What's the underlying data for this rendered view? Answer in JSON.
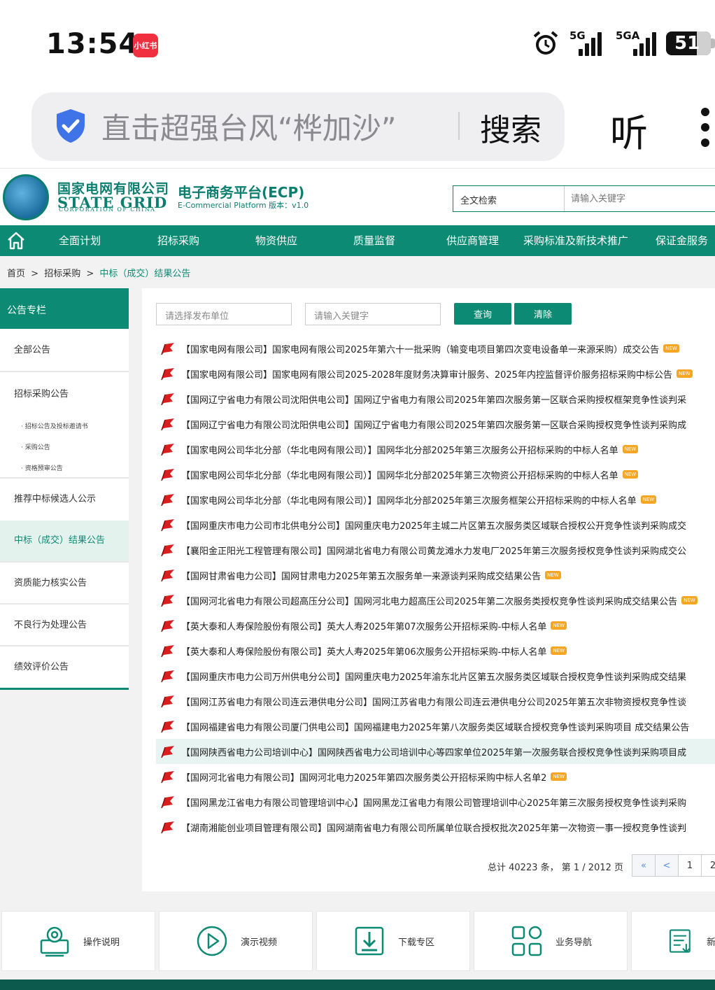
{
  "status_bar": {
    "time": "13:54",
    "app_badge": "小红书",
    "signal1_label": "5G",
    "signal2_label": "5GA",
    "battery": "51"
  },
  "browser": {
    "search_text": "直击超强台风“桦加沙”",
    "search_button": "搜索",
    "listen_button": "听"
  },
  "header": {
    "company_cn": "国家电网有限公司",
    "company_en": "STATE GRID",
    "company_en_sub": "CORPORATION OF CHINA",
    "platform_title": "电子商务平台(ECP)",
    "platform_sub": "E-Commercial Platform 版本：v1.0",
    "fulltext_label": "全文检索",
    "fulltext_placeholder": "请输入关键字"
  },
  "nav": {
    "items": [
      "全面计划",
      "招标采购",
      "物资供应",
      "质量监督",
      "供应商管理",
      "采购标准及新技术推广",
      "保证金服务"
    ]
  },
  "breadcrumb": {
    "home": "首页",
    "sep": ">",
    "level1": "招标采购",
    "current": "中标（成交）结果公告"
  },
  "sidebar": {
    "title": "公告专栏",
    "items": [
      "全部公告",
      "招标采购公告",
      "招标公告及投标邀请书",
      "采购公告",
      "资格预审公告",
      "推荐中标候选人公示",
      "中标（成交）结果公告",
      "资质能力核实公告",
      "不良行为处理公告",
      "绩效评价公告"
    ]
  },
  "filters": {
    "unit_placeholder": "请选择发布单位",
    "keyword_placeholder": "请输入关键字",
    "query_button": "查询",
    "clear_button": "清除"
  },
  "new_label": "NEW",
  "notices": [
    {
      "text": "【国家电网有限公司】国家电网有限公司2025年第六十一批采购（输变电项目第四次变电设备单一来源采购）成交公告",
      "new": true
    },
    {
      "text": "【国家电网有限公司】国家电网有限公司2025-2028年度财务决算审计服务、2025年内控监督评价服务招标采购中标公告",
      "new": true
    },
    {
      "text": "【国网辽宁省电力有限公司沈阳供电公司】国网辽宁省电力有限公司2025年第四次服务第一区联合采购授权框架竞争性谈判采",
      "new": false
    },
    {
      "text": "【国网辽宁省电力有限公司沈阳供电公司】国网辽宁省电力有限公司2025年第四次服务第一区联合采购授权竞争性谈判采购成",
      "new": false
    },
    {
      "text": "【国家电网公司华北分部（华北电网有限公司）】国网华北分部2025年第三次服务公开招标采购的中标人名单",
      "new": true
    },
    {
      "text": "【国家电网公司华北分部（华北电网有限公司）】国网华北分部2025年第三次物资公开招标采购的中标人名单",
      "new": true
    },
    {
      "text": "【国家电网公司华北分部（华北电网有限公司）】国网华北分部2025年第三次服务框架公开招标采购的中标人名单",
      "new": true
    },
    {
      "text": "【国网重庆市电力公司市北供电分公司】国网重庆电力2025年主城二片区第五次服务类区域联合授权公开竞争性谈判采购成交",
      "new": false
    },
    {
      "text": "【襄阳金正阳光工程管理有限公司】国网湖北省电力有限公司黄龙滩水力发电厂2025年第三次服务授权竞争性谈判采购成交公",
      "new": false
    },
    {
      "text": "【国网甘肃省电力公司】国网甘肃电力2025年第五次服务单一来源谈判采购成交结果公告",
      "new": true
    },
    {
      "text": "【国网河北省电力有限公司超高压分公司】国网河北电力超高压公司2025年第二次服务类授权竞争性谈判采购成交结果公告",
      "new": true
    },
    {
      "text": "【英大泰和人寿保险股份有限公司】英大人寿2025年第07次服务公开招标采购-中标人名单",
      "new": true
    },
    {
      "text": "【英大泰和人寿保险股份有限公司】英大人寿2025年第06次服务公开招标采购-中标人名单",
      "new": true
    },
    {
      "text": "【国网重庆市电力公司万州供电分公司】国网重庆电力2025年渝东北片区第五次服务类区域联合授权竞争性谈判采购成交结果",
      "new": false
    },
    {
      "text": "【国网江苏省电力有限公司连云港供电分公司】国网江苏省电力有限公司连云港供电分公司2025年第五次非物资授权竞争性谈",
      "new": false
    },
    {
      "text": "【国网福建省电力有限公司厦门供电公司】国网福建电力2025年第八次服务类区域联合授权竞争性谈判采购项目 成交结果公告",
      "new": false
    },
    {
      "text": "【国网陕西省电力公司培训中心】国网陕西省电力公司培训中心等四家单位2025年第一次服务联合授权竞争性谈判采购项目成",
      "new": false
    },
    {
      "text": "【国网河北省电力有限公司】国网河北电力2025年第四次服务类公开招标采购中标人名单2",
      "new": true
    },
    {
      "text": "【国网黑龙江省电力有限公司管理培训中心】国网黑龙江省电力有限公司管理培训中心2025年第三次服务授权竞争性谈判采购",
      "new": false
    },
    {
      "text": "【湖南湘能创业项目管理有限公司】国网湖南省电力有限公司所属单位联合授权批次2025年第一次物资一事一授权竞争性谈判",
      "new": false
    }
  ],
  "pagination": {
    "summary": "总计 40223 条，  第 1 / 2012 页",
    "first": "«",
    "prev": "<",
    "pages": [
      "1",
      "2"
    ]
  },
  "tools": [
    "操作说明",
    "演示视频",
    "下载专区",
    "业务导航",
    "新"
  ],
  "colors": {
    "brand": "#0d8a74",
    "flag": "#d81e1e",
    "new_badge": "#f4a624"
  }
}
